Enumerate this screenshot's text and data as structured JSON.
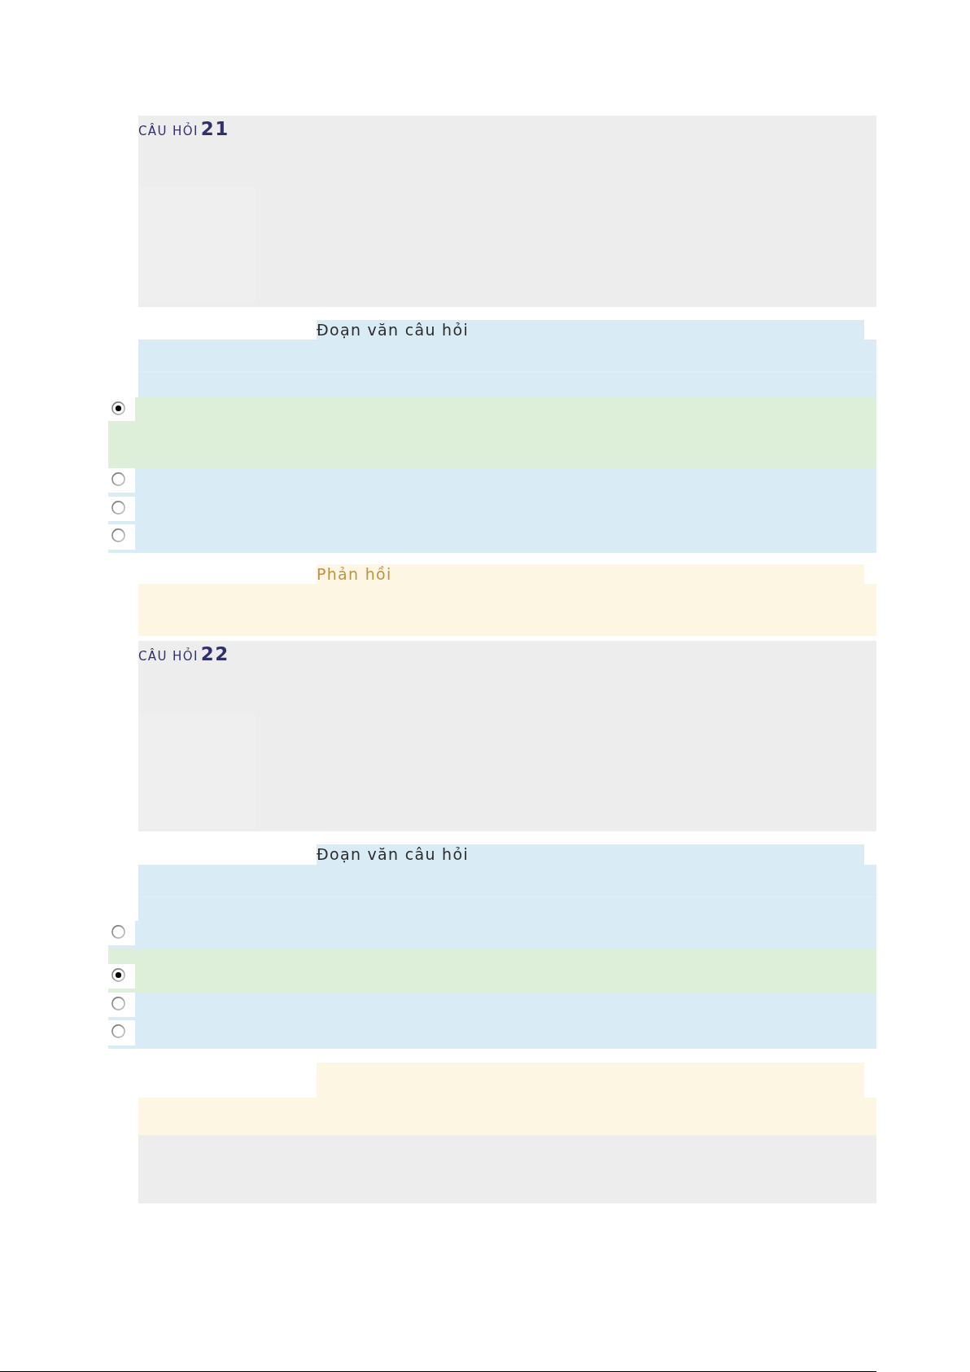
{
  "questions": [
    {
      "label": "CÂU HỎI",
      "number": "21",
      "question_text": {
        "heading": "Đoạn văn câu hỏi"
      },
      "options": [
        {
          "selected": true
        },
        {
          "selected": false
        },
        {
          "selected": false
        },
        {
          "selected": false
        }
      ],
      "feedback": {
        "shown": true,
        "heading": "Phản hồi"
      }
    },
    {
      "label": "CÂU HỎI",
      "number": "22",
      "question_text": {
        "heading": "Đoạn văn câu hỏi"
      },
      "options": [
        {
          "selected": false
        },
        {
          "selected": true
        },
        {
          "selected": false
        },
        {
          "selected": false
        }
      ],
      "feedback": {
        "shown": true
      }
    }
  ],
  "next_question": {
    "shown": true
  }
}
